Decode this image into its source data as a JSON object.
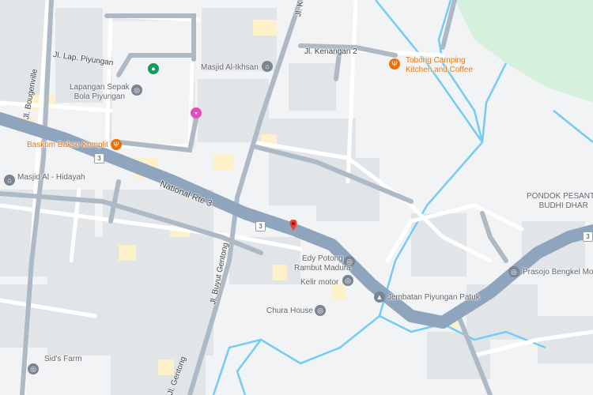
{
  "map": {
    "colors": {
      "background": "#f1f3f4",
      "building": "#e2e5e8",
      "building_yellow": "#fdf1c9",
      "road_local": "#ffffff",
      "road_main": "#8fa4bd",
      "road_side": "#aeb9c6",
      "water": "#74ccf4",
      "park": "#d6f0de"
    },
    "roads": {
      "national_route": "National Rte 3",
      "route_shield": "3",
      "jl_bougenville": "Jl. Bougenville",
      "jl_lap_piyungan": "Jl. Lap. Piyungan",
      "jl_kenangan_2": "Jl. Kenangan 2",
      "jl_buyut_gentong": "Jl. Buyut Gentong",
      "jl_gentong_bottom": "Jl. Gentong",
      "jl_top": "Jl. K"
    },
    "places": [
      {
        "id": "lapangan",
        "label": "Lapangan Sepak\nBola Piyungan",
        "icon": "sports-icon",
        "color": "#5f6368"
      },
      {
        "id": "masjid-ikhsan",
        "label": "Masjid Al-Ikhsan",
        "icon": "mosque-icon",
        "color": "#5f6368"
      },
      {
        "id": "toboria",
        "label": "Toborig Camping\nKitchen and Coffee",
        "icon": "restaurant-icon",
        "color": "#e8710a"
      },
      {
        "id": "baskom",
        "label": "Baskom Bakso Komplit",
        "icon": "restaurant-icon",
        "color": "#e8710a"
      },
      {
        "id": "masjid-hidayah",
        "label": "Masjid Al - Hidayah",
        "icon": "mosque-icon",
        "color": "#5f6368"
      },
      {
        "id": "pondok",
        "label": "PONDOK PESANTR\nBUDHI DHAR",
        "icon": "school-icon",
        "color": "#5f6368"
      },
      {
        "id": "edy",
        "label": "Edy Potong\nRambut Madura",
        "icon": "store-icon",
        "color": "#5f6368"
      },
      {
        "id": "kelir",
        "label": "Kelir motor",
        "icon": "store-icon",
        "color": "#5f6368"
      },
      {
        "id": "jembatan",
        "label": "Jembatan Piyungan Patuk",
        "icon": "landmark-icon",
        "color": "#5f6368"
      },
      {
        "id": "prasojo",
        "label": "Prasojo Bengkel Mo",
        "icon": "store-icon",
        "color": "#5f6368"
      },
      {
        "id": "chura",
        "label": "Chura House",
        "icon": "store-icon",
        "color": "#5f6368"
      },
      {
        "id": "sids-farm",
        "label": "Sid's Farm",
        "icon": "store-icon",
        "color": "#5f6368"
      }
    ]
  }
}
